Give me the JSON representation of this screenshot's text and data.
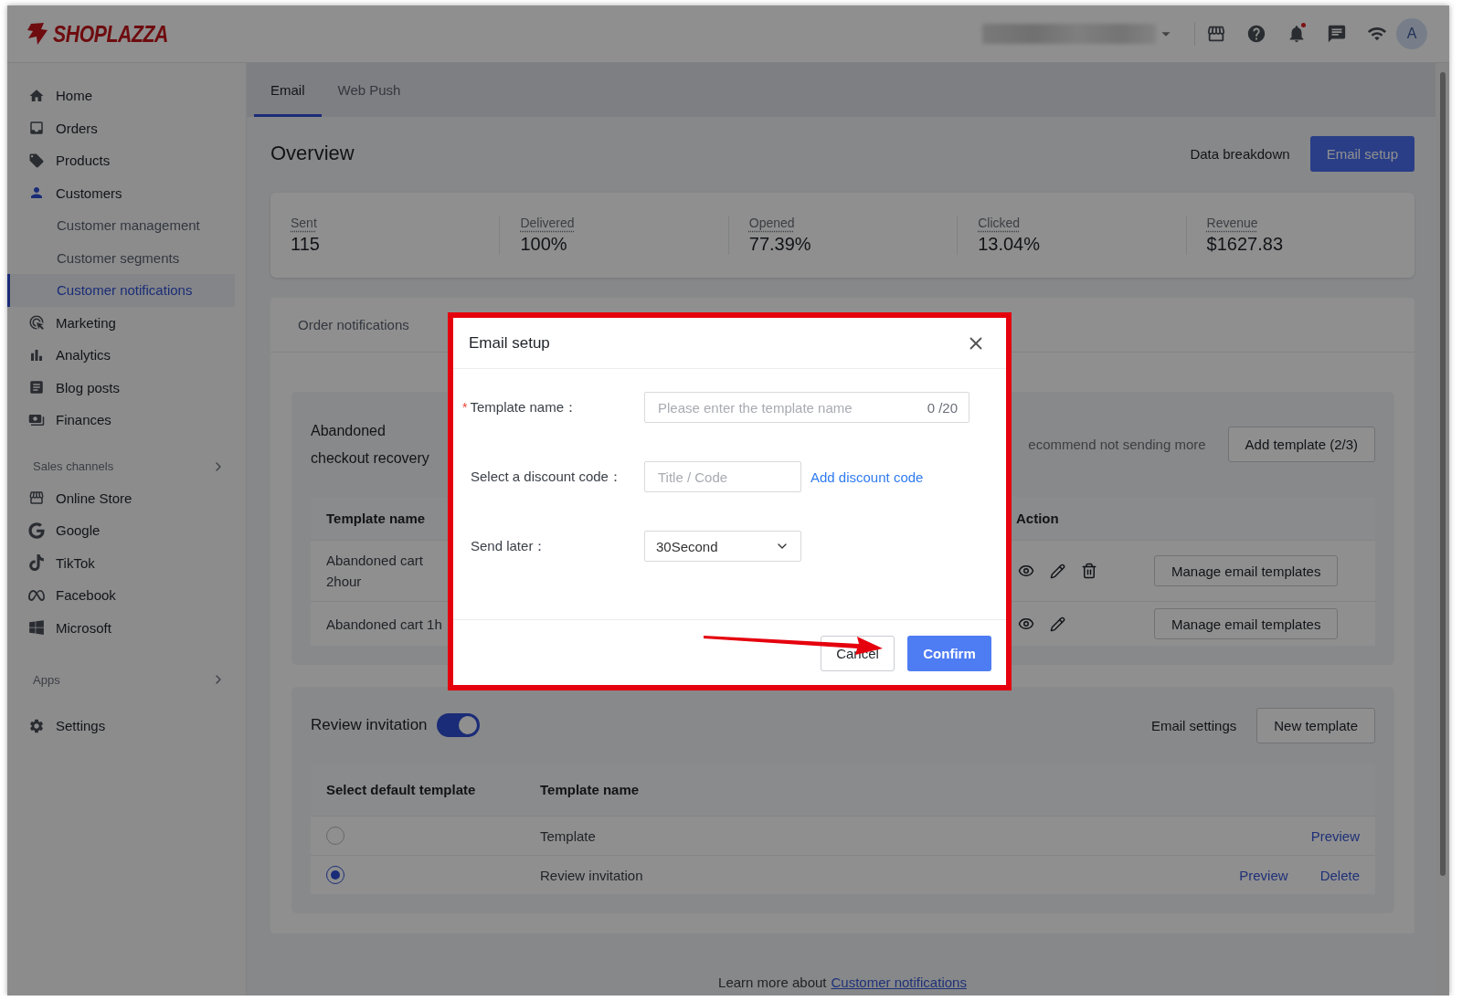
{
  "header": {
    "logo": "SHOPLAZZA",
    "avatar": "A",
    "bell_unread": true
  },
  "sidebar": {
    "items": [
      {
        "label": "Home",
        "selected": false
      },
      {
        "label": "Orders",
        "selected": false
      },
      {
        "label": "Products",
        "selected": false
      },
      {
        "label": "Customers",
        "selected": false,
        "children": [
          {
            "label": "Customer management",
            "selected": false
          },
          {
            "label": "Customer segments",
            "selected": false
          },
          {
            "label": "Customer notifications",
            "selected": true
          }
        ]
      },
      {
        "label": "Marketing",
        "selected": false
      },
      {
        "label": "Analytics",
        "selected": false
      },
      {
        "label": "Blog posts",
        "selected": false
      },
      {
        "label": "Finances",
        "selected": false
      }
    ],
    "sales_channels": {
      "heading": "Sales channels",
      "items": [
        {
          "label": "Online Store",
          "selected": false
        },
        {
          "label": "Google",
          "selected": false
        },
        {
          "label": "TikTok",
          "selected": false
        },
        {
          "label": "Facebook",
          "selected": false
        },
        {
          "label": "Microsoft",
          "selected": false
        }
      ]
    },
    "apps": {
      "heading": "Apps"
    },
    "settings": {
      "label": "Settings",
      "selected": false
    }
  },
  "tabs": [
    {
      "label": "Email",
      "selected": true
    },
    {
      "label": "Web Push",
      "selected": false
    }
  ],
  "overview": {
    "title": "Overview",
    "link": "Data breakdown",
    "button": "Email setup",
    "stats": [
      {
        "label": "Sent",
        "value": "115"
      },
      {
        "label": "Delivered",
        "value": "100%"
      },
      {
        "label": "Opened",
        "value": "77.39%"
      },
      {
        "label": "Clicked",
        "value": "13.04%"
      },
      {
        "label": "Revenue",
        "value": "$1627.83"
      }
    ]
  },
  "notifications": {
    "tabs": [
      {
        "label": "Order notifications",
        "selected": false
      }
    ],
    "abandoned": {
      "title": "Abandoned checkout recovery",
      "note": "ecommend not sending more",
      "button": "Add template (2/3)",
      "columns": [
        "Template name",
        "Action"
      ],
      "rows": [
        {
          "name": "Abandoned cart 2hour",
          "deletable": true,
          "button": "Manage email templates"
        },
        {
          "name": "Abandoned cart 1h",
          "deletable": false,
          "button": "Manage email templates"
        }
      ]
    },
    "review": {
      "title": "Review invitation",
      "on": true,
      "link": "Email settings",
      "button": "New template",
      "columns": [
        "Select default template",
        "Template name"
      ],
      "rows": [
        {
          "selected": false,
          "name": "Template",
          "links": [
            "Preview"
          ]
        },
        {
          "selected": true,
          "name": "Review invitation",
          "links": [
            "Preview",
            "Delete"
          ]
        }
      ]
    }
  },
  "footer": {
    "text": "Learn more about",
    "link": "Customer notifications"
  },
  "modal": {
    "title": "Email setup",
    "fields": [
      {
        "kind": "text",
        "required_mark": "*",
        "label": "Template name：",
        "placeholder": "Please enter the template name",
        "counter": "0 /20"
      },
      {
        "kind": "discount",
        "label": "Select a discount code：",
        "placeholder": "Title / Code",
        "link": "Add discount code"
      },
      {
        "kind": "select",
        "label": "Send later：",
        "value": "30Second"
      }
    ],
    "cancel": "Cancel",
    "confirm": "Confirm"
  }
}
